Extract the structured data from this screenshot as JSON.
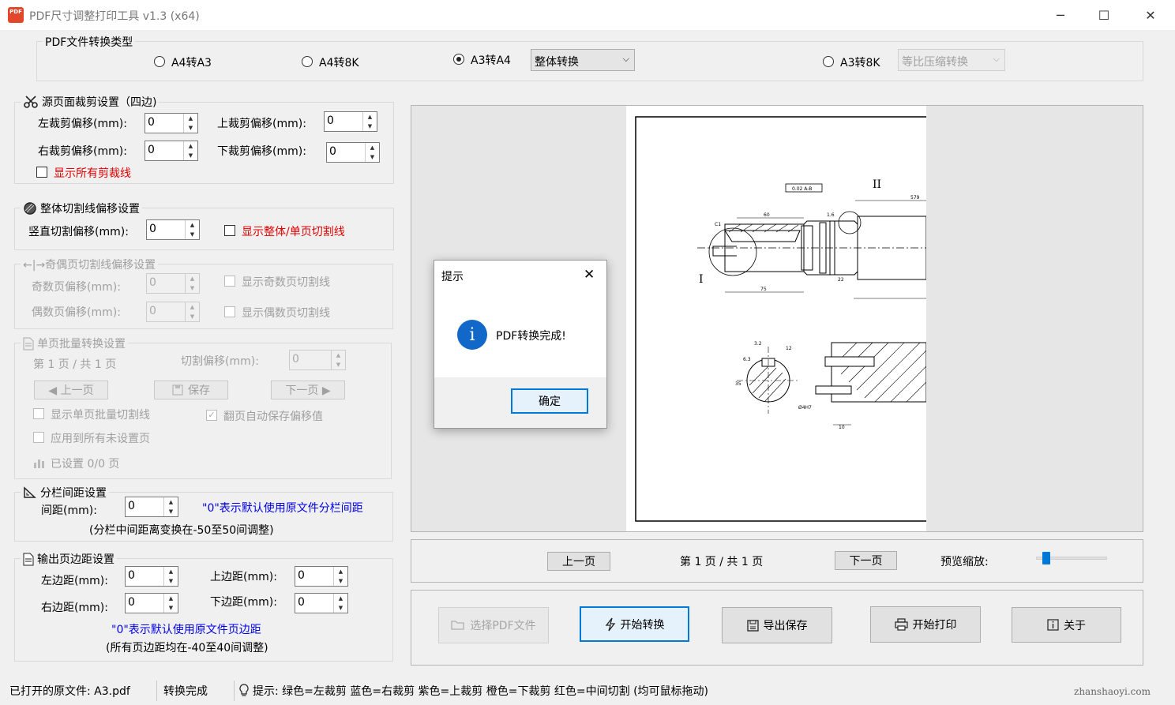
{
  "window": {
    "title": "PDF尺寸调整打印工具 v1.3   (x64)",
    "app_icon_text": "PDF",
    "minimize": "─",
    "maximize": "☐",
    "close": "✕"
  },
  "convert_type": {
    "legend": "PDF文件转换类型",
    "options": [
      "A4转A3",
      "A4转8K",
      "A3转A4",
      "A3转8K"
    ],
    "selected": "A3转A4",
    "a3a4_mode": "整体转换",
    "a38k_mode": "等比压缩转换"
  },
  "crop": {
    "legend": "源页面裁剪设置（四边)",
    "left_label": "左裁剪偏移(mm):",
    "left_value": "0",
    "top_label": "上裁剪偏移(mm):",
    "top_value": "0",
    "right_label": "右裁剪偏移(mm):",
    "right_value": "0",
    "bottom_label": "下裁剪偏移(mm):",
    "bottom_value": "0",
    "show_lines": "显示所有剪裁线"
  },
  "whole_cut": {
    "legend": "整体切割线偏移设置",
    "vertical_label": "竖直切割偏移(mm):",
    "vertical_value": "0",
    "show_lines": "显示整体/单页切割线"
  },
  "odd_even": {
    "legend": "←|→奇偶页切割线偏移设置",
    "odd_label": "奇数页偏移(mm):",
    "odd_value": "0",
    "even_label": "偶数页偏移(mm):",
    "even_value": "0",
    "show_odd": "显示奇数页切割线",
    "show_even": "显示偶数页切割线"
  },
  "single_batch": {
    "legend": "单页批量转换设置",
    "page_info": "第 1 页 / 共 1 页",
    "cut_offset_label": "切割偏移(mm):",
    "cut_offset_value": "0",
    "prev": "◀ 上一页",
    "save": "保存",
    "next": "下一页 ▶",
    "show_batch_lines": "显示单页批量切割线",
    "auto_save": "翻页自动保存偏移值",
    "apply_all": "应用到所有未设置页",
    "set_count": "已设置 0/0 页"
  },
  "column_gap": {
    "legend": "分栏间距设置",
    "gap_label": "间距(mm):",
    "gap_value": "0",
    "hint": "\"0\"表示默认使用原文件分栏间距",
    "range": "(分栏中间距离变换在-50至50间调整)"
  },
  "margins": {
    "legend": "输出页边距设置",
    "left_label": "左边距(mm):",
    "left_value": "0",
    "top_label": "上边距(mm):",
    "top_value": "0",
    "right_label": "右边距(mm):",
    "right_value": "0",
    "bottom_label": "下边距(mm):",
    "bottom_value": "0",
    "hint": "\"0\"表示默认使用原文件页边距",
    "range": "(所有页边距均在-40至40间调整)"
  },
  "preview": {
    "prev": "上一页",
    "page_info": "第 1 页 / 共 1 页",
    "next": "下一页",
    "zoom_label": "预览缩放:",
    "zoom_fraction": 0.1,
    "drawing_labels": {
      "roman1": "I",
      "roman2": "II",
      "tol": "0.02 A-B",
      "d1": "579",
      "d2": "60",
      "d3": "C1",
      "d4": "1.6",
      "d5": "75",
      "d6": "22",
      "d7": "12",
      "d8": "3.2",
      "d9": "6.3",
      "d10": "10",
      "d11": "Ø4H7",
      "d12": "35",
      "d13": "3.2",
      "d14": "1.6"
    }
  },
  "actions": {
    "select_pdf": "选择PDF文件",
    "start_convert": "开始转换",
    "export_save": "导出保存",
    "start_print": "开始打印",
    "about": "关于"
  },
  "dialog": {
    "title": "提示",
    "message": "PDF转换完成!",
    "ok": "确定",
    "icon_glyph": "i"
  },
  "status": {
    "file": "已打开的原文件: A3.pdf",
    "state": "转换完成",
    "tip": "提示:  绿色=左裁剪 蓝色=右裁剪 紫色=上裁剪 橙色=下裁剪 红色=中间切割 (均可鼠标拖动)",
    "watermark": "zhanshaoyi.com"
  }
}
